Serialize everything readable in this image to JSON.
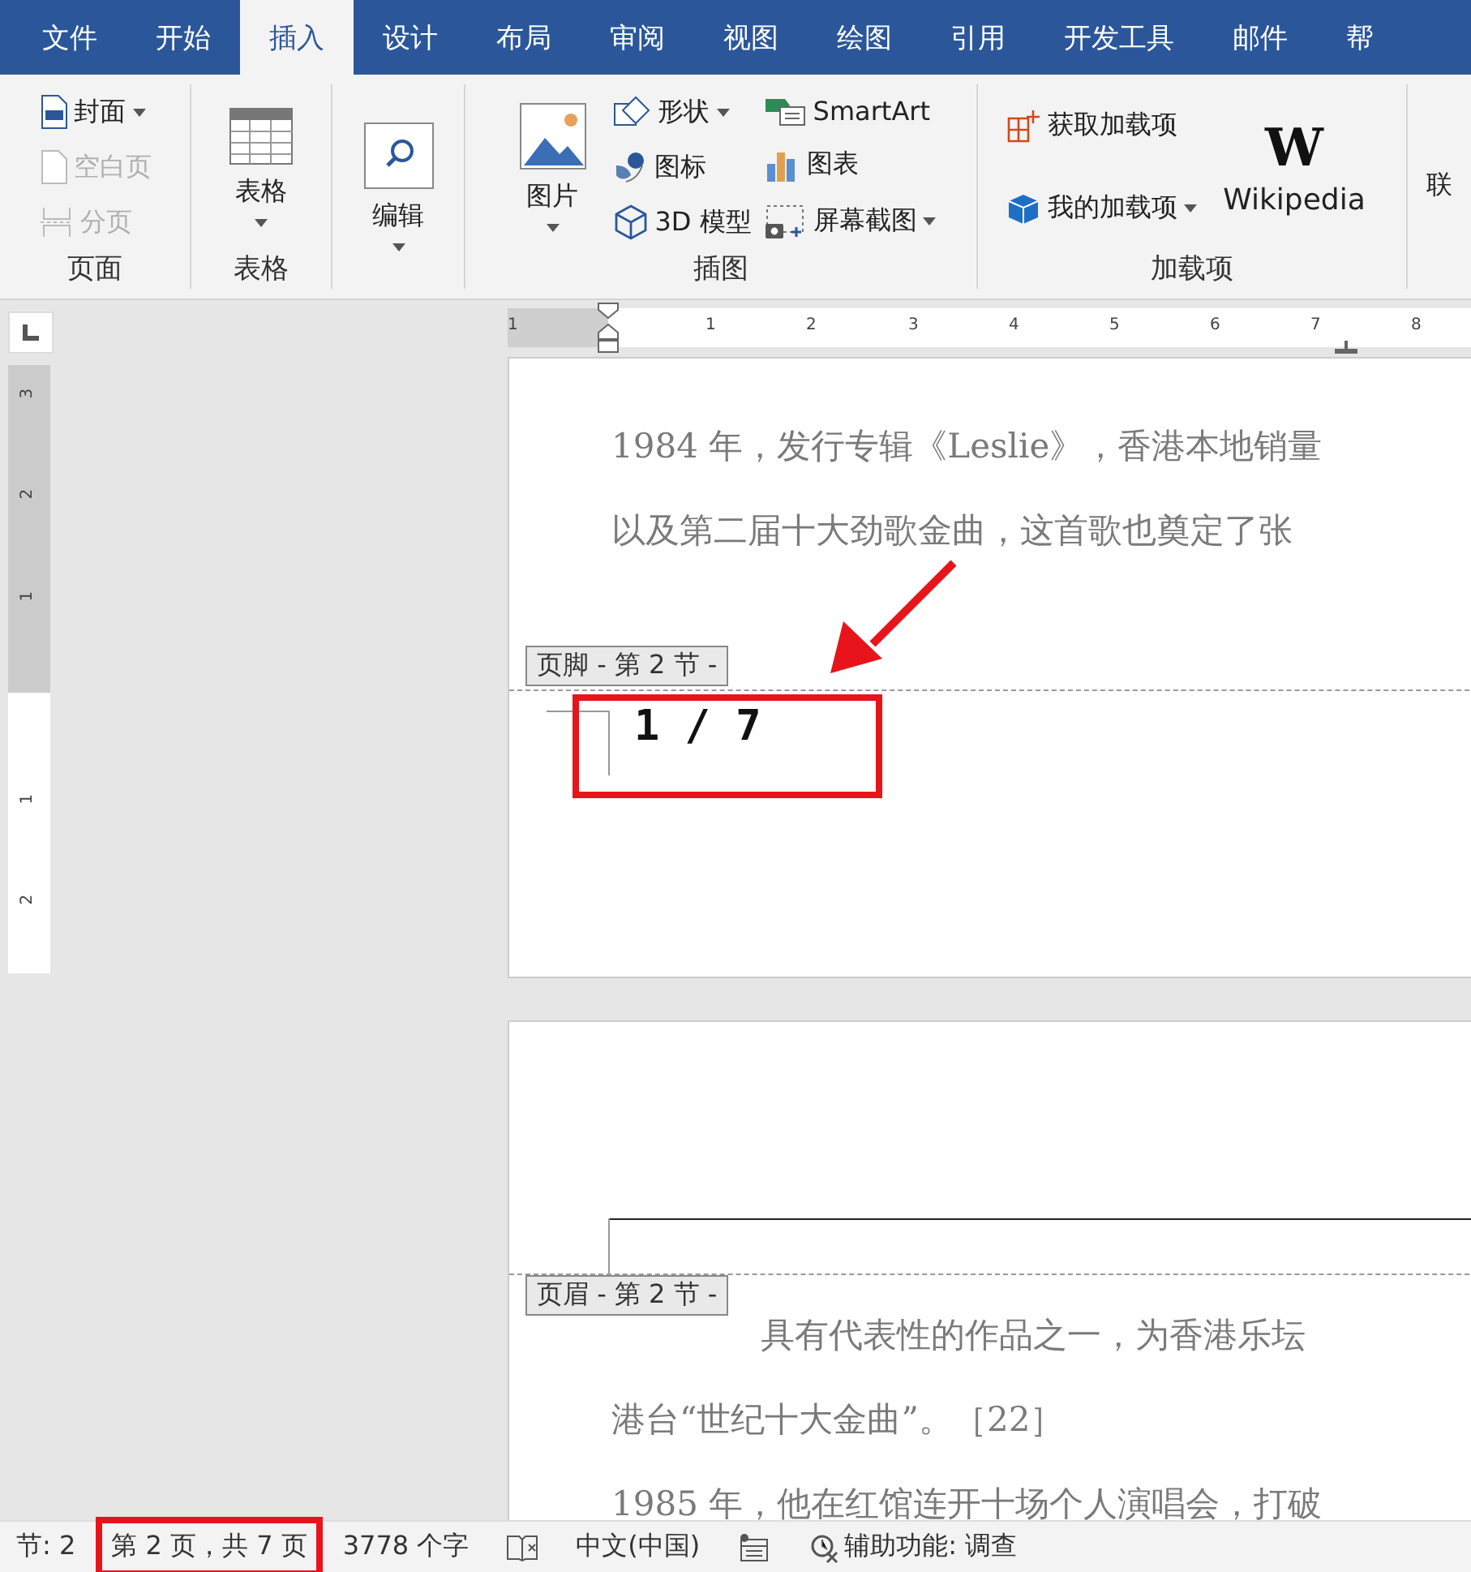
{
  "tabs": [
    {
      "label": "文件",
      "selected": false
    },
    {
      "label": "开始",
      "selected": false
    },
    {
      "label": "插入",
      "selected": true
    },
    {
      "label": "设计",
      "selected": false
    },
    {
      "label": "布局",
      "selected": false
    },
    {
      "label": "审阅",
      "selected": false
    },
    {
      "label": "视图",
      "selected": false
    },
    {
      "label": "绘图",
      "selected": false
    },
    {
      "label": "引用",
      "selected": false
    },
    {
      "label": "开发工具",
      "selected": false
    },
    {
      "label": "邮件",
      "selected": false
    },
    {
      "label": "帮",
      "selected": false
    }
  ],
  "ribbon": {
    "groups": [
      {
        "label": "页面",
        "columns": [
          [
            {
              "kind": "small",
              "label": "封面",
              "dropdown": true,
              "disabled": false
            },
            {
              "kind": "small",
              "label": "空白页",
              "dropdown": false,
              "disabled": true
            },
            {
              "kind": "small",
              "label": "分页",
              "dropdown": false,
              "disabled": true
            }
          ]
        ]
      },
      {
        "label": "表格",
        "columns": [
          [
            {
              "kind": "large",
              "label": "表格",
              "dropdown": true,
              "disabled": false
            }
          ]
        ]
      },
      {
        "columns": [
          [
            {
              "kind": "large",
              "label": "编辑",
              "dropdown": true,
              "disabled": false
            }
          ]
        ]
      },
      {
        "label": "插图",
        "columns": [
          [
            {
              "kind": "large",
              "label": "图片",
              "dropdown": true,
              "disabled": false
            }
          ],
          [
            {
              "kind": "small",
              "label": "形状",
              "dropdown": true,
              "disabled": false
            },
            {
              "kind": "small",
              "label": "图标",
              "dropdown": false,
              "disabled": false
            },
            {
              "kind": "small",
              "label": "3D 模型",
              "dropdown": false,
              "disabled": false
            }
          ],
          [
            {
              "kind": "small",
              "label": "SmartArt",
              "dropdown": false,
              "disabled": false
            },
            {
              "kind": "small",
              "label": "图表",
              "dropdown": false,
              "disabled": false
            },
            {
              "kind": "small",
              "label": "屏幕截图",
              "dropdown": true,
              "disabled": false
            }
          ]
        ]
      },
      {
        "label": "加载项",
        "columns": [
          [
            {
              "kind": "small",
              "label": "获取加载项",
              "dropdown": false,
              "disabled": false
            },
            {
              "kind": "small",
              "label": "我的加载项",
              "dropdown": true,
              "disabled": false
            }
          ],
          [
            {
              "kind": "logo",
              "logo": "W",
              "label": "Wikipedia",
              "dropdown": false,
              "disabled": false
            }
          ]
        ]
      },
      {
        "columns": [
          [
            {
              "kind": "text",
              "label": "联",
              "dropdown": false,
              "disabled": false
            }
          ]
        ]
      }
    ]
  },
  "rulers": {
    "horizontal": [
      "1",
      "1",
      "2",
      "3",
      "4",
      "5",
      "6",
      "7",
      "8"
    ],
    "vertical": [
      "3",
      "2",
      "1",
      "1",
      "2"
    ]
  },
  "pages": [
    {
      "lines": [
        "1984 年，发行专辑《Leslie》，香港本地销量",
        "以及第二届十大劲歌金曲，这首歌也奠定了张"
      ],
      "footer": {
        "tag": "页脚 - 第 2 节 -",
        "text": "1 / 7"
      }
    },
    {
      "header": {
        "tag": "页眉 - 第 2 节 -"
      },
      "lines": [
        "具有代表性的作品之一，为香港乐坛",
        "港台“世纪十大金曲”。［22］",
        "1985 年，他在红馆连开十场个人演唱会，打破"
      ]
    }
  ],
  "status_bar": [
    {
      "kind": "text",
      "text": "节: 2"
    },
    {
      "kind": "text",
      "text": "第 2 页，共 7 页"
    },
    {
      "kind": "text",
      "text": "3778 个字"
    },
    {
      "kind": "icon"
    },
    {
      "kind": "text",
      "text": "中文(中国)"
    },
    {
      "kind": "icon"
    },
    {
      "kind": "icon_text",
      "text": "辅助功能: 调查"
    }
  ]
}
